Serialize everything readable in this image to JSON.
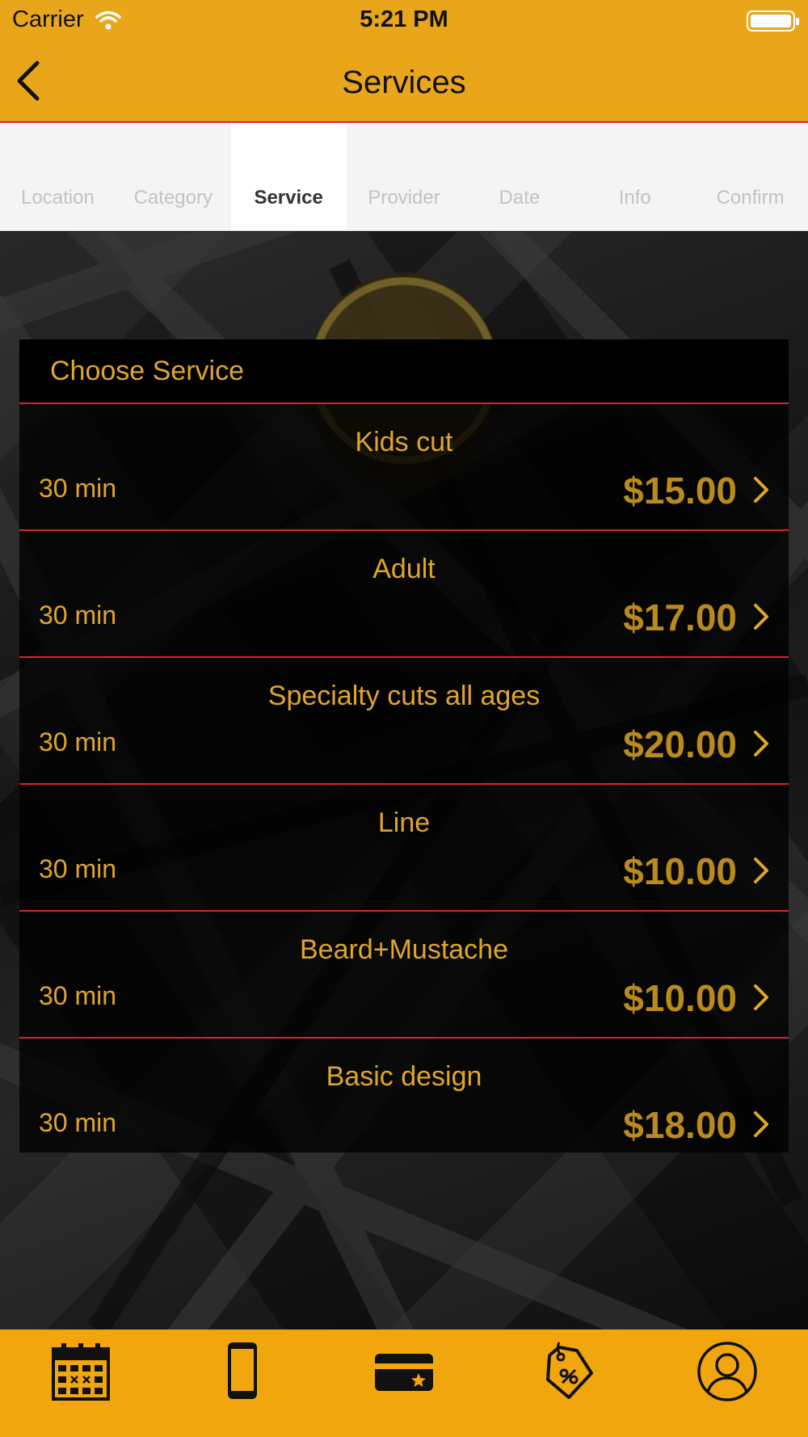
{
  "status_bar": {
    "carrier": "Carrier",
    "time": "5:21 PM"
  },
  "nav": {
    "title": "Services",
    "back_icon": "chevron-left-icon"
  },
  "steps": [
    {
      "label": "Location",
      "active": false
    },
    {
      "label": "Category",
      "active": false
    },
    {
      "label": "Service",
      "active": true
    },
    {
      "label": "Provider",
      "active": false
    },
    {
      "label": "Date",
      "active": false
    },
    {
      "label": "Info",
      "active": false
    },
    {
      "label": "Confirm",
      "active": false
    }
  ],
  "card": {
    "title": "Choose Service",
    "services": [
      {
        "name": "Kids cut",
        "duration": "30 min",
        "price": "$15.00"
      },
      {
        "name": "Adult",
        "duration": "30 min",
        "price": "$17.00"
      },
      {
        "name": "Specialty cuts all ages",
        "duration": "30 min",
        "price": "$20.00"
      },
      {
        "name": "Line",
        "duration": "30 min",
        "price": "$10.00"
      },
      {
        "name": "Beard+Mustache",
        "duration": "30 min",
        "price": "$10.00"
      },
      {
        "name": "Basic design",
        "duration": "30 min",
        "price": "$18.00"
      }
    ]
  },
  "tab_bar": [
    {
      "icon": "calendar-icon"
    },
    {
      "icon": "phone-icon"
    },
    {
      "icon": "card-icon"
    },
    {
      "icon": "discount-tag-icon"
    },
    {
      "icon": "profile-icon"
    }
  ],
  "colors": {
    "accent": "#eaa61a",
    "divider": "#d8242a",
    "text_gold": "#e0a52b",
    "price_gold": "#b98a1c",
    "tab_bar": "#f2a60e"
  }
}
